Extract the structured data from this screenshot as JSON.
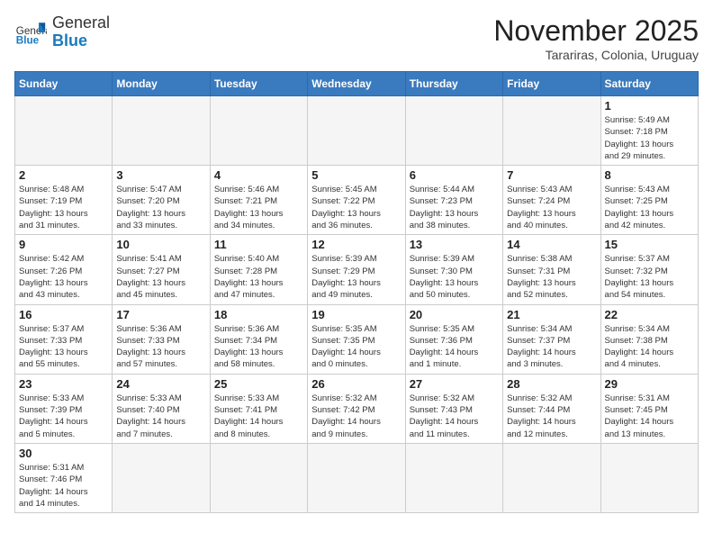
{
  "header": {
    "logo_general": "General",
    "logo_blue": "Blue",
    "month_title": "November 2025",
    "location": "Tarariras, Colonia, Uruguay"
  },
  "weekdays": [
    "Sunday",
    "Monday",
    "Tuesday",
    "Wednesday",
    "Thursday",
    "Friday",
    "Saturday"
  ],
  "weeks": [
    [
      {
        "day": "",
        "info": ""
      },
      {
        "day": "",
        "info": ""
      },
      {
        "day": "",
        "info": ""
      },
      {
        "day": "",
        "info": ""
      },
      {
        "day": "",
        "info": ""
      },
      {
        "day": "",
        "info": ""
      },
      {
        "day": "1",
        "info": "Sunrise: 5:49 AM\nSunset: 7:18 PM\nDaylight: 13 hours\nand 29 minutes."
      }
    ],
    [
      {
        "day": "2",
        "info": "Sunrise: 5:48 AM\nSunset: 7:19 PM\nDaylight: 13 hours\nand 31 minutes."
      },
      {
        "day": "3",
        "info": "Sunrise: 5:47 AM\nSunset: 7:20 PM\nDaylight: 13 hours\nand 33 minutes."
      },
      {
        "day": "4",
        "info": "Sunrise: 5:46 AM\nSunset: 7:21 PM\nDaylight: 13 hours\nand 34 minutes."
      },
      {
        "day": "5",
        "info": "Sunrise: 5:45 AM\nSunset: 7:22 PM\nDaylight: 13 hours\nand 36 minutes."
      },
      {
        "day": "6",
        "info": "Sunrise: 5:44 AM\nSunset: 7:23 PM\nDaylight: 13 hours\nand 38 minutes."
      },
      {
        "day": "7",
        "info": "Sunrise: 5:43 AM\nSunset: 7:24 PM\nDaylight: 13 hours\nand 40 minutes."
      },
      {
        "day": "8",
        "info": "Sunrise: 5:43 AM\nSunset: 7:25 PM\nDaylight: 13 hours\nand 42 minutes."
      }
    ],
    [
      {
        "day": "9",
        "info": "Sunrise: 5:42 AM\nSunset: 7:26 PM\nDaylight: 13 hours\nand 43 minutes."
      },
      {
        "day": "10",
        "info": "Sunrise: 5:41 AM\nSunset: 7:27 PM\nDaylight: 13 hours\nand 45 minutes."
      },
      {
        "day": "11",
        "info": "Sunrise: 5:40 AM\nSunset: 7:28 PM\nDaylight: 13 hours\nand 47 minutes."
      },
      {
        "day": "12",
        "info": "Sunrise: 5:39 AM\nSunset: 7:29 PM\nDaylight: 13 hours\nand 49 minutes."
      },
      {
        "day": "13",
        "info": "Sunrise: 5:39 AM\nSunset: 7:30 PM\nDaylight: 13 hours\nand 50 minutes."
      },
      {
        "day": "14",
        "info": "Sunrise: 5:38 AM\nSunset: 7:31 PM\nDaylight: 13 hours\nand 52 minutes."
      },
      {
        "day": "15",
        "info": "Sunrise: 5:37 AM\nSunset: 7:32 PM\nDaylight: 13 hours\nand 54 minutes."
      }
    ],
    [
      {
        "day": "16",
        "info": "Sunrise: 5:37 AM\nSunset: 7:33 PM\nDaylight: 13 hours\nand 55 minutes."
      },
      {
        "day": "17",
        "info": "Sunrise: 5:36 AM\nSunset: 7:33 PM\nDaylight: 13 hours\nand 57 minutes."
      },
      {
        "day": "18",
        "info": "Sunrise: 5:36 AM\nSunset: 7:34 PM\nDaylight: 13 hours\nand 58 minutes."
      },
      {
        "day": "19",
        "info": "Sunrise: 5:35 AM\nSunset: 7:35 PM\nDaylight: 14 hours\nand 0 minutes."
      },
      {
        "day": "20",
        "info": "Sunrise: 5:35 AM\nSunset: 7:36 PM\nDaylight: 14 hours\nand 1 minute."
      },
      {
        "day": "21",
        "info": "Sunrise: 5:34 AM\nSunset: 7:37 PM\nDaylight: 14 hours\nand 3 minutes."
      },
      {
        "day": "22",
        "info": "Sunrise: 5:34 AM\nSunset: 7:38 PM\nDaylight: 14 hours\nand 4 minutes."
      }
    ],
    [
      {
        "day": "23",
        "info": "Sunrise: 5:33 AM\nSunset: 7:39 PM\nDaylight: 14 hours\nand 5 minutes."
      },
      {
        "day": "24",
        "info": "Sunrise: 5:33 AM\nSunset: 7:40 PM\nDaylight: 14 hours\nand 7 minutes."
      },
      {
        "day": "25",
        "info": "Sunrise: 5:33 AM\nSunset: 7:41 PM\nDaylight: 14 hours\nand 8 minutes."
      },
      {
        "day": "26",
        "info": "Sunrise: 5:32 AM\nSunset: 7:42 PM\nDaylight: 14 hours\nand 9 minutes."
      },
      {
        "day": "27",
        "info": "Sunrise: 5:32 AM\nSunset: 7:43 PM\nDaylight: 14 hours\nand 11 minutes."
      },
      {
        "day": "28",
        "info": "Sunrise: 5:32 AM\nSunset: 7:44 PM\nDaylight: 14 hours\nand 12 minutes."
      },
      {
        "day": "29",
        "info": "Sunrise: 5:31 AM\nSunset: 7:45 PM\nDaylight: 14 hours\nand 13 minutes."
      }
    ],
    [
      {
        "day": "30",
        "info": "Sunrise: 5:31 AM\nSunset: 7:46 PM\nDaylight: 14 hours\nand 14 minutes."
      },
      {
        "day": "",
        "info": ""
      },
      {
        "day": "",
        "info": ""
      },
      {
        "day": "",
        "info": ""
      },
      {
        "day": "",
        "info": ""
      },
      {
        "day": "",
        "info": ""
      },
      {
        "day": "",
        "info": ""
      }
    ]
  ]
}
